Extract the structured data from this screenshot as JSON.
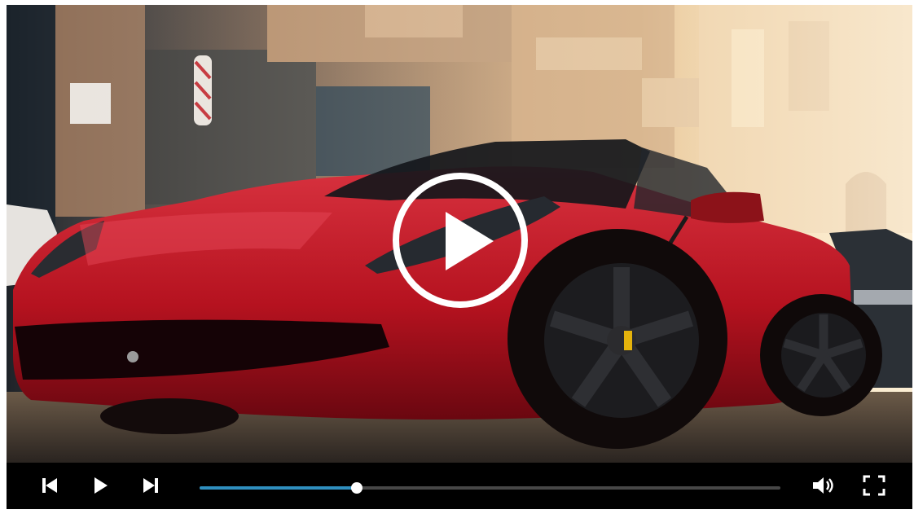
{
  "video": {
    "frame_description_icon": "video-frame",
    "play_overlay_icon": "play-icon"
  },
  "controls": {
    "previous_icon": "skip-previous-icon",
    "play_icon": "play-icon",
    "next_icon": "skip-next-icon",
    "volume_icon": "volume-icon",
    "fullscreen_icon": "fullscreen-icon",
    "progress_fraction": 0.27,
    "progress_color": "#2f8fbf"
  }
}
